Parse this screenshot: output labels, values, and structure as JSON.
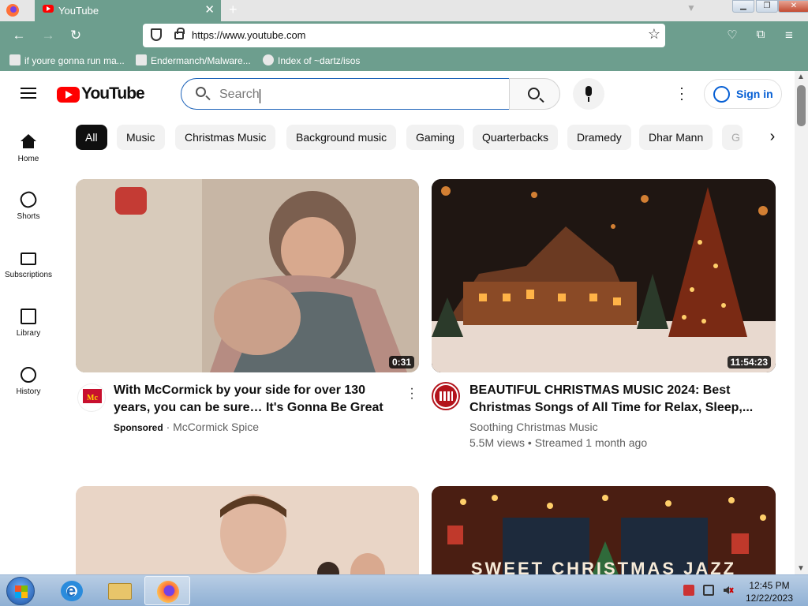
{
  "browser": {
    "tab_title": "YouTube",
    "tab_close": "✕",
    "new_tab": "+",
    "url": "https://www.youtube.com",
    "bookmarks": [
      "if youre gonna run ma...",
      "Endermanch/Malware...",
      "Index of ~dartz/isos"
    ]
  },
  "youtube": {
    "logo_text": "YouTube",
    "search_placeholder": "Search",
    "sign_in": "Sign in",
    "nav": [
      {
        "label": "Home",
        "icon": "home-icon"
      },
      {
        "label": "Shorts",
        "icon": "shorts-icon"
      },
      {
        "label": "Subscriptions",
        "icon": "subscriptions-icon"
      },
      {
        "label": "Library",
        "icon": "library-icon"
      },
      {
        "label": "History",
        "icon": "history-icon"
      }
    ],
    "chips": [
      "All",
      "Music",
      "Christmas Music",
      "Background music",
      "Gaming",
      "Quarterbacks",
      "Dramedy",
      "Dhar Mann",
      "G"
    ],
    "videos": [
      {
        "title": "With McCormick by your side for over 130 years, you can be sure… It's Gonna Be Great",
        "duration": "0:31",
        "sponsored": "Sponsored",
        "channel": "McCormick Spice"
      },
      {
        "title": "BEAUTIFUL CHRISTMAS MUSIC 2024: Best Christmas Songs of All Time for Relax, Sleep,...",
        "duration": "11:54:23",
        "channel": "Soothing Christmas Music",
        "meta": "5.5M views • Streamed 1 month ago"
      }
    ],
    "bottom_thumb_text": "SWEET CHRISTMAS JAZZ"
  },
  "taskbar": {
    "time": "12:45 PM",
    "date": "12/22/2023"
  },
  "colors": {
    "firefox_theme": "#6d9e8e",
    "youtube_red": "#ff0000",
    "signin_blue": "#065fd4",
    "active_chip": "#0f0f0f"
  }
}
